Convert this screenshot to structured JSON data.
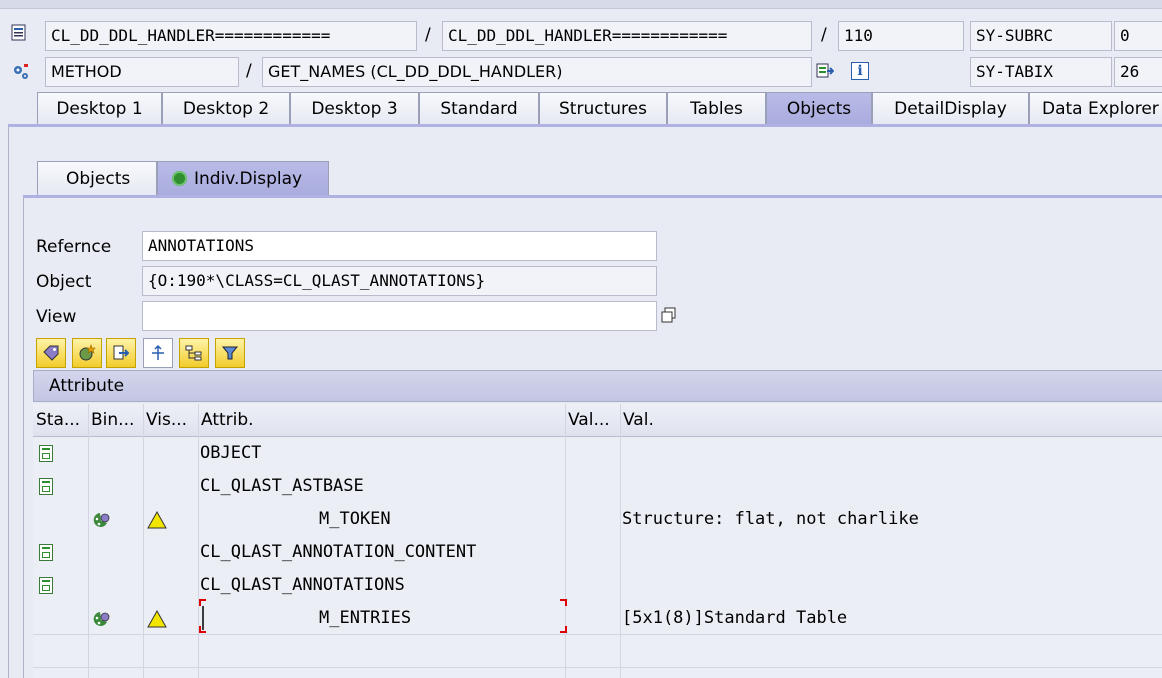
{
  "header": {
    "row1": {
      "field1": "CL_DD_DDL_HANDLER============",
      "sep1": "/",
      "field2": "CL_DD_DDL_HANDLER============",
      "sep2": "/",
      "line": "110",
      "sysvar_name": "SY-SUBRC",
      "sysvar_value": "0"
    },
    "row2": {
      "kind": "METHOD",
      "sep": "/",
      "method": "GET_NAMES (CL_DD_DDL_HANDLER)",
      "sysvar_name": "SY-TABIX",
      "sysvar_value": "26"
    }
  },
  "main_tabs": [
    {
      "label": "Desktop 1"
    },
    {
      "label": "Desktop 2"
    },
    {
      "label": "Desktop 3"
    },
    {
      "label": "Standard"
    },
    {
      "label": "Structures"
    },
    {
      "label": "Tables"
    },
    {
      "label": "Objects"
    },
    {
      "label": "DetailDisplay"
    },
    {
      "label": "Data Explorer"
    }
  ],
  "sub_tabs": [
    {
      "label": "Objects"
    },
    {
      "label": "Indiv.Display"
    }
  ],
  "form": {
    "reference_label": "Refernce",
    "reference_value": "ANNOTATIONS",
    "object_label": "Object",
    "object_value": "{O:190*\\CLASS=CL_QLAST_ANNOTATIONS}",
    "view_label": "View",
    "view_value": ""
  },
  "grid": {
    "title": "Attribute",
    "columns": [
      "Sta...",
      "Bin...",
      "Vis...",
      "Attrib.",
      "Val...",
      "Val."
    ],
    "rows": [
      {
        "attrib": "OBJECT",
        "value": ""
      },
      {
        "attrib": "CL_QLAST_ASTBASE",
        "value": ""
      },
      {
        "attrib": "M_TOKEN",
        "value": "Structure: flat, not charlike"
      },
      {
        "attrib": "CL_QLAST_ANNOTATION_CONTENT",
        "value": ""
      },
      {
        "attrib": "CL_QLAST_ANNOTATIONS",
        "value": ""
      },
      {
        "attrib": "M_ENTRIES",
        "value": "[5x1(8)]Standard Table"
      }
    ]
  },
  "colors": {
    "background": "#e9ebf4",
    "active_tab": "#aeb1e2",
    "toolbar_button": "#f2cc2c",
    "warning": "#f2e600",
    "status_green": "#2f8f2f"
  }
}
